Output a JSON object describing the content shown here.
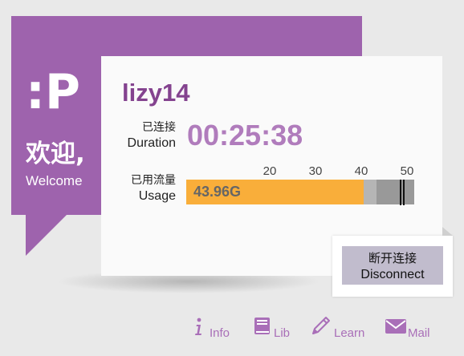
{
  "brand": {
    "logo_text": ":P",
    "welcome_cn": "欢迎,",
    "welcome_en": "Welcome"
  },
  "user": {
    "name": "lizy14"
  },
  "duration": {
    "label_cn": "已连接",
    "label_en": "Duration",
    "value": "00:25:38"
  },
  "usage": {
    "label_cn": "已用流量",
    "label_en": "Usage",
    "value": "43.96G",
    "used_gb": 43.96,
    "light_segment_end_gb": 46.6,
    "scale_min_gb": 9.0,
    "scale_max_gb": 54.0,
    "limit_gb": 51.0,
    "ticks": [
      "20",
      "30",
      "40",
      "50"
    ],
    "colors": {
      "used": "#f9ae3a",
      "light": "#b5b5b5",
      "remaining": "#999999"
    }
  },
  "disconnect": {
    "label_cn": "断开连接",
    "label_en": "Disconnect"
  },
  "links": [
    {
      "icon": "info-icon",
      "label": "Info"
    },
    {
      "icon": "book-icon",
      "label": "Lib"
    },
    {
      "icon": "pencil-icon",
      "label": "Learn"
    },
    {
      "icon": "mail-icon",
      "label": "Mail"
    }
  ],
  "colors": {
    "brand_purple": "#9e63ad",
    "username": "#84438f",
    "duration": "#b07cbc",
    "link": "#a96fb8",
    "button": "#c1bccd"
  }
}
